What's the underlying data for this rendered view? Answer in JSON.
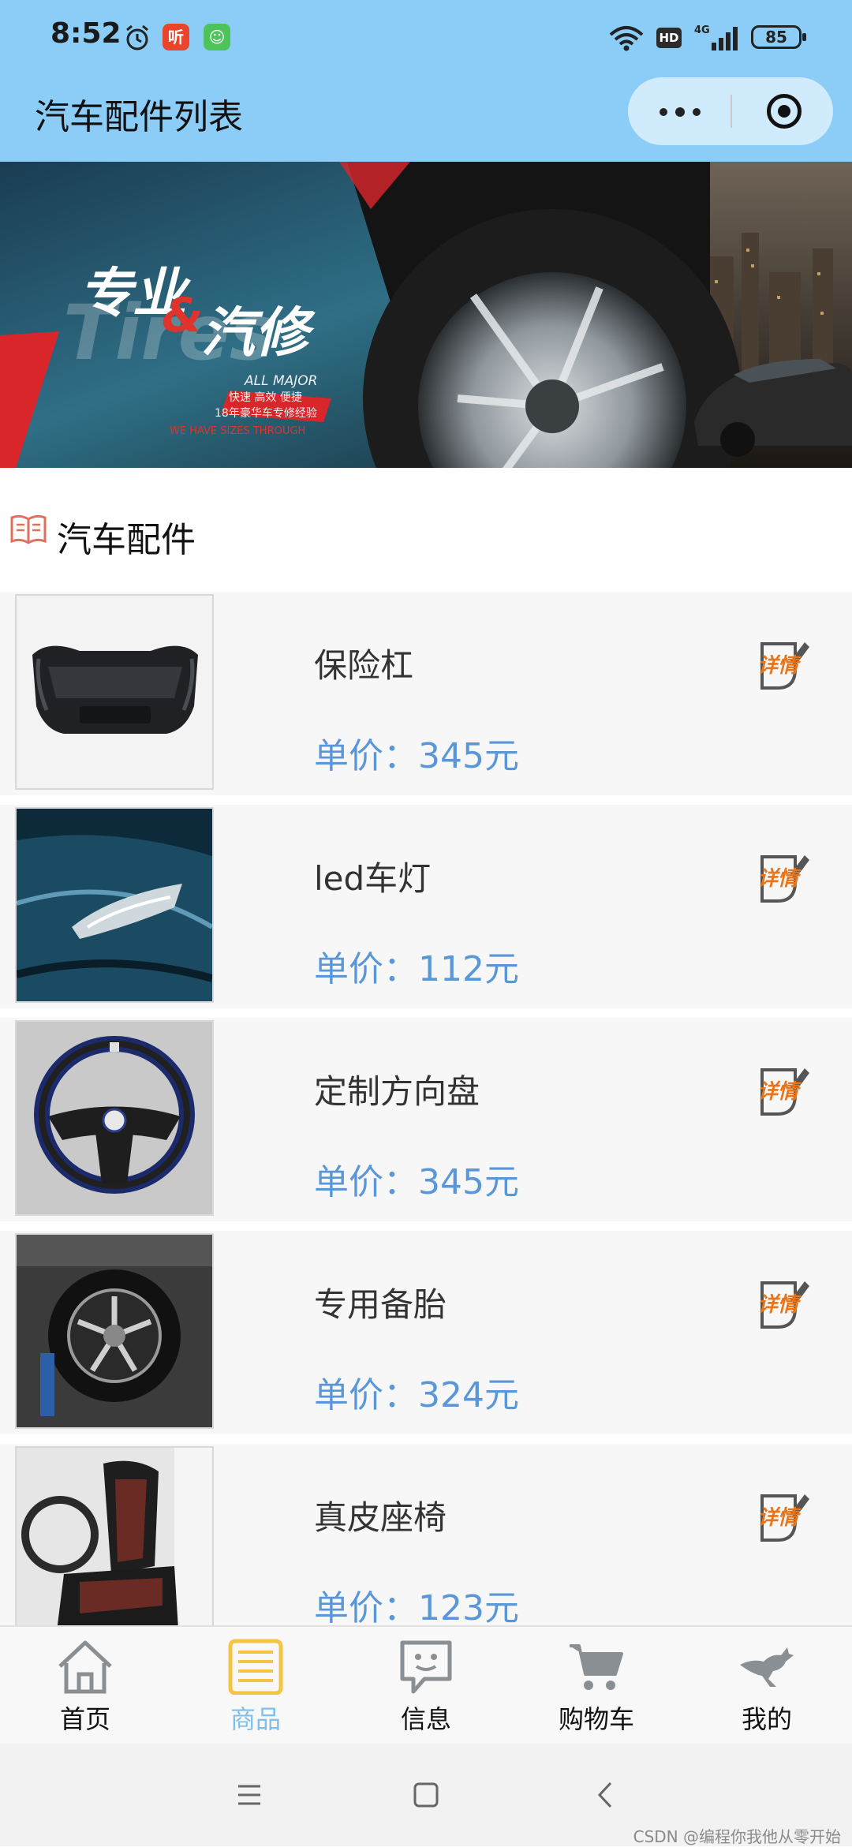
{
  "status_bar": {
    "time": "8:52",
    "badge_1": "听",
    "network": "4G",
    "hd": "HD",
    "battery": "85"
  },
  "header": {
    "title": "汽车配件列表",
    "accent_color": "#8bcdf6"
  },
  "banner": {
    "headline": "专业&汽修",
    "sub_en": "ALL MAJOR",
    "sub_cn": "快速 高效 便捷",
    "sub_years": "18年豪华车专修经验",
    "sub_en2": "WE HAVE SIZES  THROUGH",
    "bg_word": "Tires"
  },
  "section": {
    "title": "汽车配件",
    "icon": "book-icon"
  },
  "products": [
    {
      "name": "保险杠",
      "price": "单价：345元",
      "thumb": "bumper"
    },
    {
      "name": "led车灯",
      "price": "单价：112元",
      "thumb": "headlight"
    },
    {
      "name": "定制方向盘",
      "price": "单价：345元",
      "thumb": "steering-wheel"
    },
    {
      "name": "专用备胎",
      "price": "单价：324元",
      "thumb": "spare-tire"
    },
    {
      "name": "真皮座椅",
      "price": "单价：123元",
      "thumb": "leather-seat"
    }
  ],
  "detail_label": "详情",
  "tabs": [
    {
      "label": "首页",
      "icon": "home-icon"
    },
    {
      "label": "商品",
      "icon": "list-icon",
      "active": true
    },
    {
      "label": "信息",
      "icon": "message-icon"
    },
    {
      "label": "购物车",
      "icon": "cart-icon"
    },
    {
      "label": "我的",
      "icon": "kangaroo-icon"
    }
  ],
  "colors": {
    "price": "#5a97d8",
    "tab_active": "#7fc0ea",
    "detail_orange": "#e8751a"
  },
  "watermark": "CSDN @编程你我他从零开始"
}
